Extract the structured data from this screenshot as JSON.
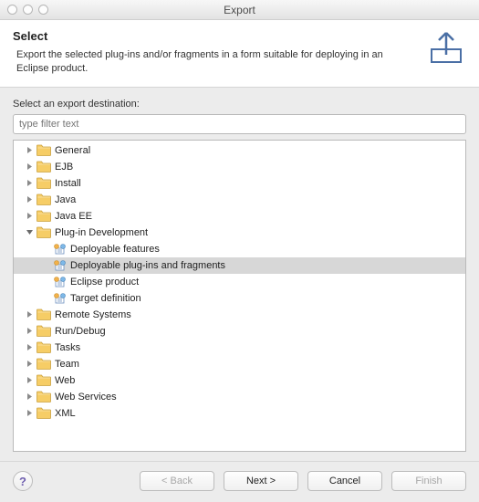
{
  "window": {
    "title": "Export"
  },
  "header": {
    "title": "Select",
    "description": "Export the selected plug-ins and/or fragments in a form suitable for deploying in an Eclipse product."
  },
  "body": {
    "section_label": "Select an export destination:",
    "filter_placeholder": "type filter text",
    "tree": [
      {
        "label": "General",
        "type": "folder",
        "depth": 1,
        "expanded": false
      },
      {
        "label": "EJB",
        "type": "folder",
        "depth": 1,
        "expanded": false
      },
      {
        "label": "Install",
        "type": "folder",
        "depth": 1,
        "expanded": false
      },
      {
        "label": "Java",
        "type": "folder",
        "depth": 1,
        "expanded": false
      },
      {
        "label": "Java EE",
        "type": "folder",
        "depth": 1,
        "expanded": false
      },
      {
        "label": "Plug-in Development",
        "type": "folder",
        "depth": 1,
        "expanded": true
      },
      {
        "label": "Deployable features",
        "type": "leaf",
        "depth": 2,
        "selected": false
      },
      {
        "label": "Deployable plug-ins and fragments",
        "type": "leaf",
        "depth": 2,
        "selected": true
      },
      {
        "label": "Eclipse product",
        "type": "leaf",
        "depth": 2,
        "selected": false
      },
      {
        "label": "Target definition",
        "type": "leaf",
        "depth": 2,
        "selected": false
      },
      {
        "label": "Remote Systems",
        "type": "folder",
        "depth": 1,
        "expanded": false
      },
      {
        "label": "Run/Debug",
        "type": "folder",
        "depth": 1,
        "expanded": false
      },
      {
        "label": "Tasks",
        "type": "folder",
        "depth": 1,
        "expanded": false
      },
      {
        "label": "Team",
        "type": "folder",
        "depth": 1,
        "expanded": false
      },
      {
        "label": "Web",
        "type": "folder",
        "depth": 1,
        "expanded": false
      },
      {
        "label": "Web Services",
        "type": "folder",
        "depth": 1,
        "expanded": false
      },
      {
        "label": "XML",
        "type": "folder",
        "depth": 1,
        "expanded": false
      }
    ]
  },
  "footer": {
    "help": "?",
    "back": "< Back",
    "next": "Next >",
    "cancel": "Cancel",
    "finish": "Finish"
  }
}
